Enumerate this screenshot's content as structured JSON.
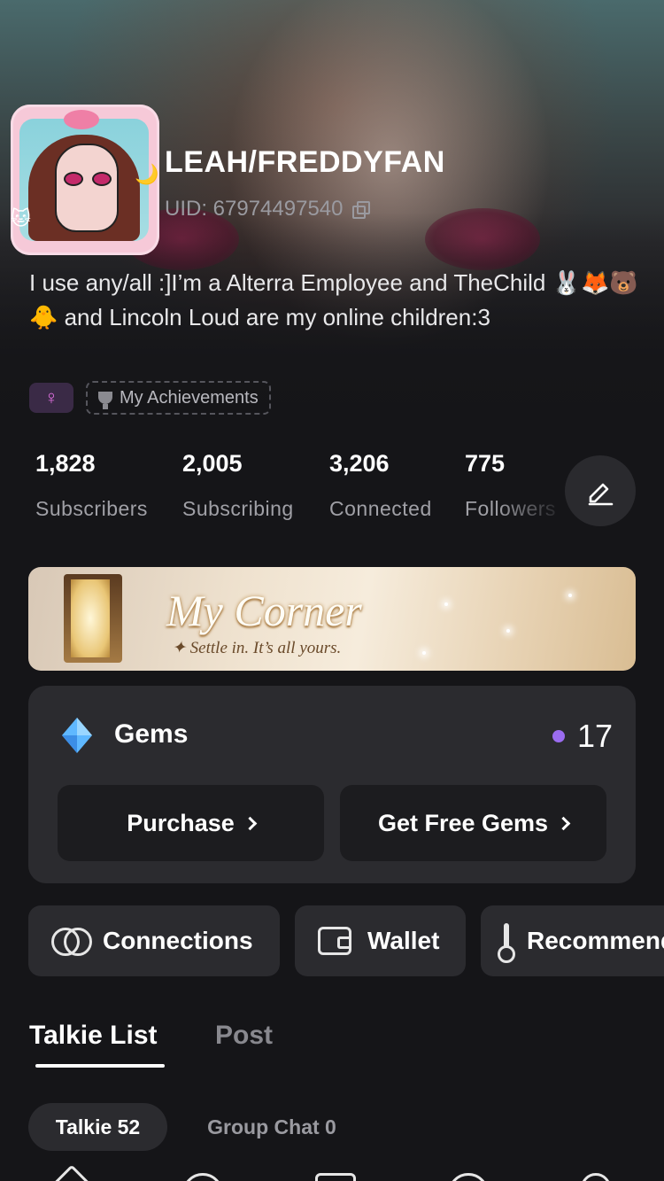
{
  "profile": {
    "username": "LEAH/FREDDYFAN",
    "uid": "UID: 67974497540",
    "bio": "I use any/all :]I’m a Alterra Employee and TheChild 🐰🦊🐻🐥 and Lincoln Loud are my online children:3",
    "gender_symbol": "♀",
    "achievements_label": "My Achievements"
  },
  "stats": [
    {
      "value": "1,828",
      "label": "Subscribers"
    },
    {
      "value": "2,005",
      "label": "Subscribing"
    },
    {
      "value": "3,206",
      "label": "Connected"
    },
    {
      "value": "775",
      "label": "Followers"
    }
  ],
  "banner": {
    "title": "My Corner",
    "subtitle": "✦ Settle in. It’s all yours."
  },
  "gems": {
    "title": "Gems",
    "count": "17",
    "purchase_label": "Purchase",
    "free_label": "Get Free Gems"
  },
  "quick_actions": [
    {
      "label": "Connections",
      "icon": "connections-icon"
    },
    {
      "label": "Wallet",
      "icon": "wallet-icon"
    },
    {
      "label": "Recommend",
      "icon": "recommend-icon"
    }
  ],
  "tabs": [
    {
      "label": "Talkie List",
      "active": true
    },
    {
      "label": "Post",
      "active": false
    }
  ],
  "sub_tabs": [
    {
      "label": "Talkie 52",
      "active": true
    },
    {
      "label": "Group Chat 0",
      "active": false
    }
  ],
  "colors": {
    "background": "#151518",
    "card": "#2b2b2f",
    "accent_purple": "#9b6cf0",
    "muted_text": "#a0a0a6"
  }
}
